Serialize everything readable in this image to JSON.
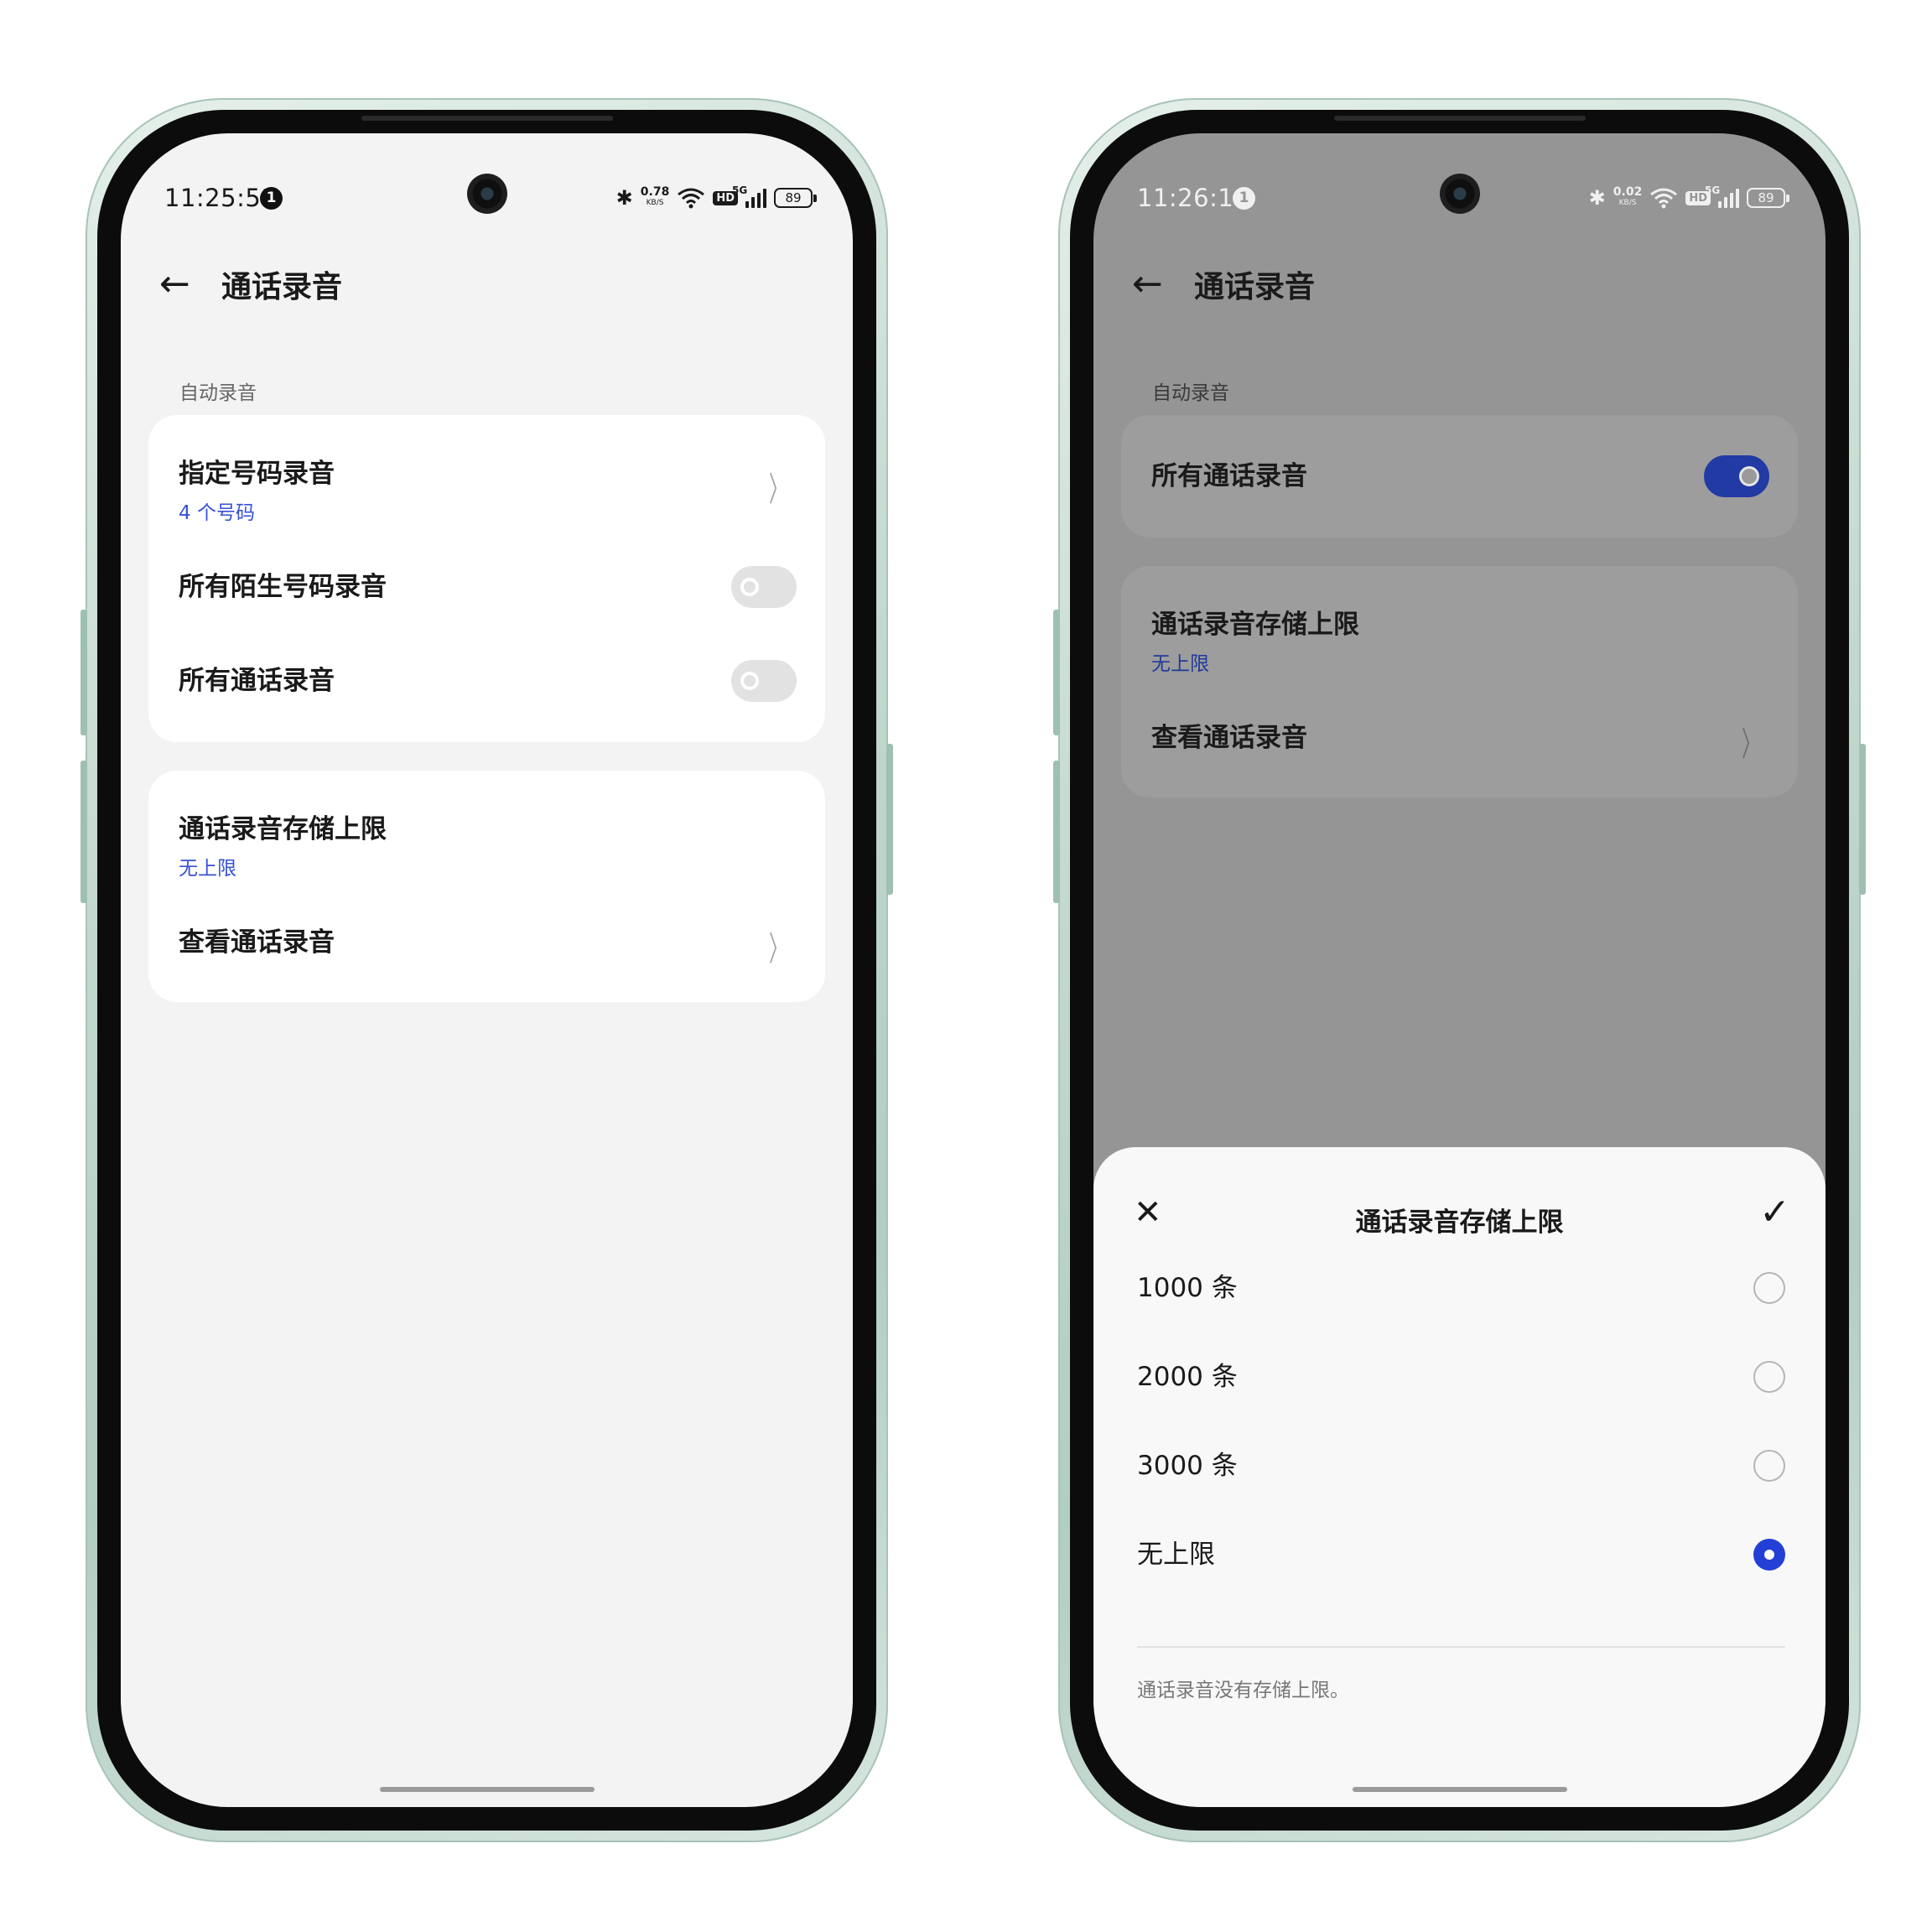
{
  "left": {
    "status": {
      "time": "11:25:51",
      "notif": "1",
      "net_speed": "0.78",
      "net_unit": "KB/S",
      "hd": "HD",
      "net_gen": "5G",
      "battery": "89"
    },
    "header": {
      "title": "通话录音"
    },
    "section_label": "自动录音",
    "auto_card": {
      "designated": {
        "title": "指定号码录音",
        "sub": "4 个号码"
      },
      "strangers": {
        "title": "所有陌生号码录音",
        "toggle": "off"
      },
      "all_calls": {
        "title": "所有通话录音",
        "toggle": "off"
      }
    },
    "storage_card": {
      "limit": {
        "title": "通话录音存储上限",
        "sub": "无上限"
      },
      "view": {
        "title": "查看通话录音"
      }
    }
  },
  "right": {
    "status": {
      "time": "11:26:16",
      "notif": "1",
      "net_speed": "0.02",
      "net_unit": "KB/S",
      "hd": "HD",
      "net_gen": "5G",
      "battery": "89"
    },
    "header": {
      "title": "通话录音"
    },
    "section_label": "自动录音",
    "auto_card": {
      "all_calls": {
        "title": "所有通话录音",
        "toggle": "on"
      }
    },
    "storage_card": {
      "limit": {
        "title": "通话录音存储上限",
        "sub": "无上限"
      },
      "view": {
        "title": "查看通话录音"
      }
    },
    "sheet": {
      "title": "通话录音存储上限",
      "options": [
        {
          "label": "1000 条",
          "selected": false
        },
        {
          "label": "2000 条",
          "selected": false
        },
        {
          "label": "3000 条",
          "selected": false
        },
        {
          "label": "无上限",
          "selected": true
        }
      ],
      "note": "通话录音没有存储上限。"
    }
  },
  "colors": {
    "accent": "#233fd6",
    "link": "#3652d3",
    "frame": "#b8d1c6",
    "dim": "#959595"
  }
}
